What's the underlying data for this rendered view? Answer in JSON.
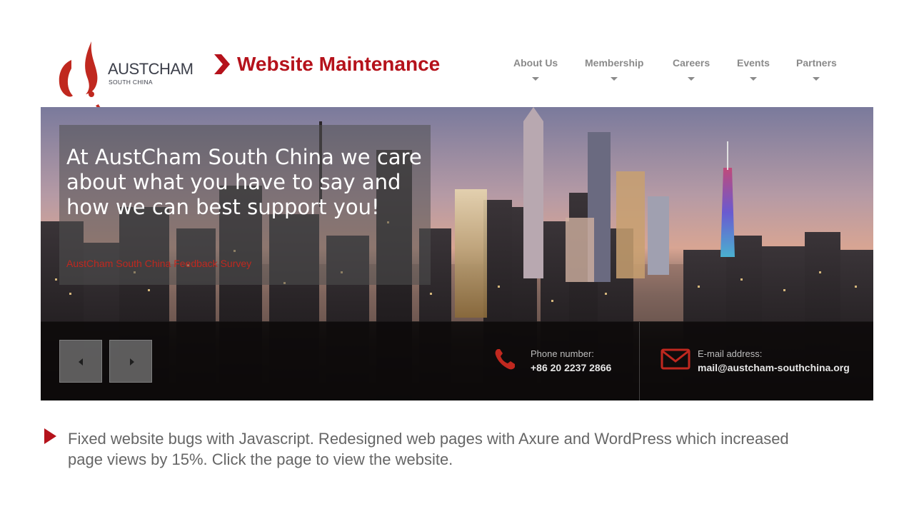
{
  "logo": {
    "brand_main": "AUSTCHAM",
    "brand_sub": "SOUTH CHINA",
    "accent": "#c0281f"
  },
  "slide": {
    "title": "Website Maintenance",
    "title_color": "#b5121b"
  },
  "nav": {
    "items": [
      {
        "label": "About Us"
      },
      {
        "label": "Membership"
      },
      {
        "label": "Careers"
      },
      {
        "label": "Events"
      },
      {
        "label": "Partners"
      }
    ],
    "dropdown_icon": "caret-down-icon"
  },
  "hero": {
    "headline": "At AustCham South China we care about what you have to say and how we can best support you!",
    "link_text": "AustCham South China Feedback Survey",
    "prev_icon": "arrow-left-icon",
    "next_icon": "arrow-right-icon",
    "phone": {
      "label": "Phone number:",
      "value": "+86 20 2237 2866",
      "icon": "phone-icon"
    },
    "email": {
      "label": "E-mail address:",
      "value": "mail@austcham-southchina.org",
      "icon": "envelope-icon"
    }
  },
  "description": {
    "text": "Fixed website bugs with Javascript. Redesigned web pages with Axure and WordPress which increased page views by 15%. Click the page to view the website.",
    "bullet_color": "#b5121b"
  }
}
